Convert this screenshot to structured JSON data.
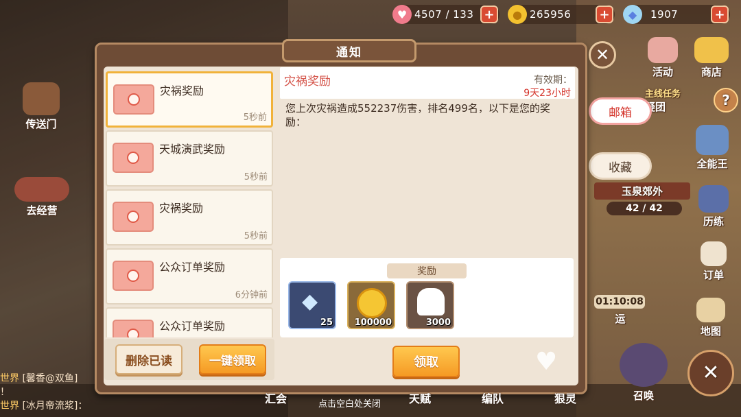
{
  "resources": {
    "stamina": "4507 / 133",
    "gold": "265956",
    "crystal": "1907"
  },
  "dialog": {
    "title": "通知"
  },
  "mail_list": [
    {
      "title": "灾祸奖励",
      "time": "5秒前",
      "selected": true
    },
    {
      "title": "天城演武奖励",
      "time": "5秒前",
      "selected": false
    },
    {
      "title": "灾祸奖励",
      "time": "5秒前",
      "selected": false
    },
    {
      "title": "公众订单奖励",
      "time": "6分钟前",
      "selected": false
    },
    {
      "title": "公众订单奖励",
      "time": "",
      "selected": false
    }
  ],
  "list_buttons": {
    "delete_read": "删除已读",
    "claim_all": "一键领取"
  },
  "detail": {
    "title": "灾祸奖励",
    "valid_label": "有效期：",
    "valid_value": "9天23小时",
    "body": "您上次灾祸造成552237伤害，排名499名，以下是您的奖励："
  },
  "rewards": {
    "label": "奖励",
    "items": [
      {
        "icon": "crystal-icon",
        "count": "25"
      },
      {
        "icon": "gold-coin-icon",
        "count": "100000"
      },
      {
        "icon": "chef-hat-icon",
        "count": "3000"
      }
    ]
  },
  "claim_button": "领取",
  "side_tabs": {
    "mailbox": "邮箱",
    "favorites": "收藏"
  },
  "hud": {
    "portal": "传送门",
    "go_manage": "去经营",
    "events": "活动",
    "shop": "商店",
    "main_quest": "主线任务",
    "quest_sub": "疑团",
    "quest_help": "?",
    "omnipotent": "全能王",
    "location": "玉泉郊外",
    "location_progress": "42 / 42",
    "training": "历练",
    "orders": "订单",
    "timer": "01:10:08",
    "delivery": "运",
    "map": "地图",
    "summon": "召唤"
  },
  "bottom_nav": {
    "item1": "汇会",
    "item2": "天赋",
    "item3": "编队",
    "item4": "狠灵"
  },
  "chat": {
    "line1_tag": "世界",
    "line1_text": "[馨香@双鱼]",
    "line1_cont": "！",
    "line2_tag": "世界",
    "line2_text": "[冰月帝流浆]："
  },
  "hint": "点击空白处关闭",
  "colors": {
    "accent_orange": "#f59a24",
    "title_red": "#d4544a",
    "dialog_brown": "#6e4c36"
  }
}
